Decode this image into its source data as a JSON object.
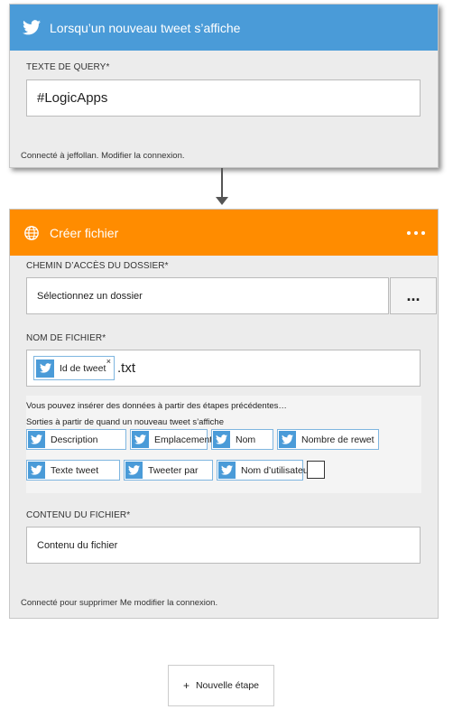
{
  "trigger": {
    "title": "Lorsqu’un nouveau tweet s’affiche",
    "query_label": "TEXTE DE QUERY",
    "query_value": "#LogicApps",
    "connection_text": "Connecté à jeffollan. Modifier la connexion."
  },
  "action": {
    "title": "Créer fichier",
    "folder_label": "CHEMIN D’ACCÈS DU DOSSIER",
    "folder_placeholder": "Sélectionnez un dossier",
    "browse_label": "...",
    "filename_label": "NOM DE FICHIER",
    "filename_token": "Id de tweet",
    "filename_suffix": ".txt",
    "dynamic_hint": "Vous pouvez insérer des données à partir des étapes précédentes…",
    "outputs_label": "Sorties à partir de quand un nouveau tweet s’affiche",
    "outputs": [
      "Description",
      "Emplacement",
      "Nom",
      "Nombre de rewet",
      "Texte tweet",
      "Tweeter par",
      "Nom d’utilisateur"
    ],
    "content_label": "CONTENU DU FICHIER",
    "content_placeholder": "Contenu du fichier",
    "connection_text": "Connecté pour supprimer Me modifier la connexion."
  },
  "new_step": {
    "label": "Nouvelle étape"
  },
  "colors": {
    "twitter_blue": "#4a9bd8",
    "action_orange": "#ff8c00"
  },
  "icons": {
    "trigger": "twitter-bird-icon",
    "action": "globe-icon",
    "menu": "more-dots-icon",
    "remove_token": "close-icon",
    "add": "plus-icon"
  }
}
